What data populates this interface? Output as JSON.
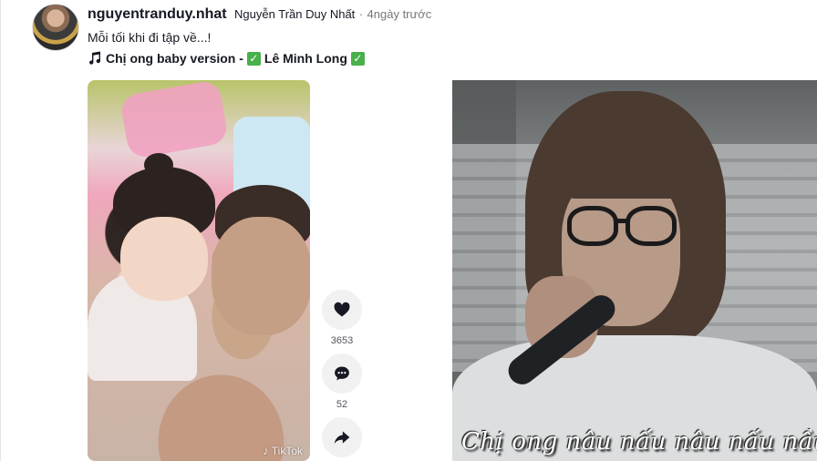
{
  "post": {
    "author_id": "nguyentranduy.nhat",
    "author_nick": "Nguyễn Trần Duy Nhất",
    "separator": "·",
    "time": "4ngày trước",
    "caption": "Mỗi tối khi đi tập về...!",
    "music_note_icon": "music-note-icon",
    "music_title": "Chị ong baby version - ",
    "music_artist": "Lê Minh Long",
    "check_glyph": "✓"
  },
  "video": {
    "watermark": "TikTok",
    "watermark_icon": "tiktok-logo-icon"
  },
  "actions": {
    "like_count": "3653",
    "comment_count": "52",
    "icons": [
      "heart-icon",
      "comment-icon",
      "share-icon"
    ]
  },
  "right_image": {
    "subtitle": "Chị ong nâu nấu nâu nấu nầu nâu.."
  },
  "colors": {
    "text": "#161823",
    "muted": "rgba(22,24,35,0.6)",
    "check_green": "#47b04b",
    "button_bg": "#f1f1f2"
  }
}
